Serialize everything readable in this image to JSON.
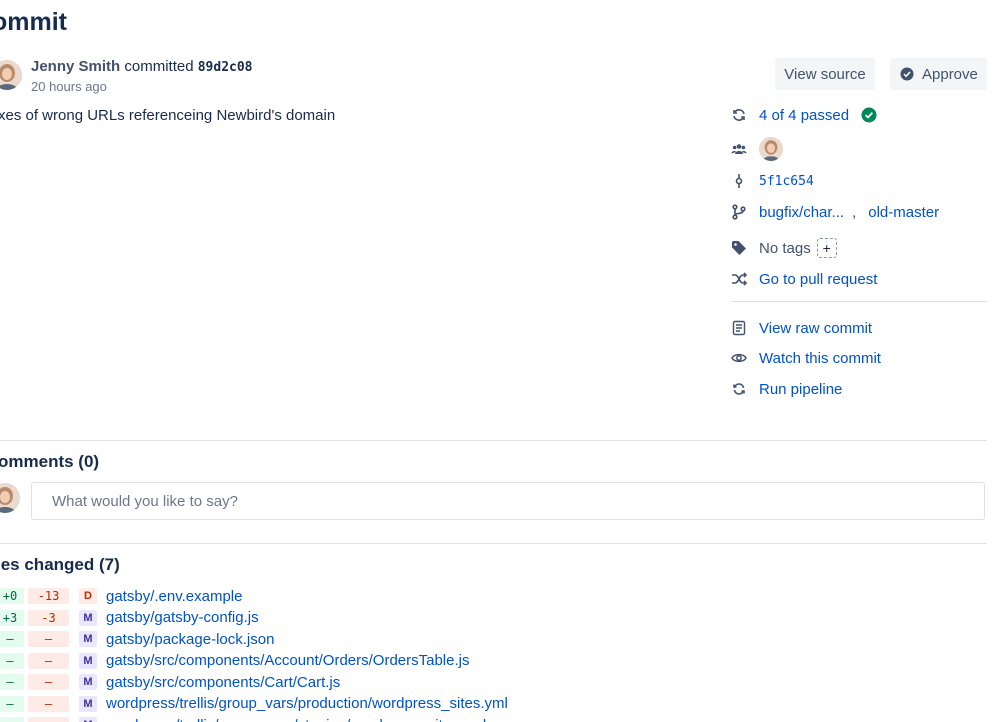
{
  "page": {
    "title": "ommit"
  },
  "commit": {
    "author": "Jenny Smith",
    "verb": "committed",
    "hash": "89d2c08",
    "time_ago": "20 hours ago",
    "message": "xes of wrong URLs referenceing Newbird's domain"
  },
  "actions": {
    "view_source": "View source",
    "approve": "Approve"
  },
  "sidebar": {
    "builds": "4 of 4 passed",
    "parent_hash": "5f1c654",
    "branch_1": "bugfix/char...",
    "branch_sep": ",",
    "branch_2": "old-master",
    "tags": "No tags",
    "tag_add": "+",
    "pull_request": "Go to pull request",
    "view_raw": "View raw commit",
    "watch": "Watch this commit",
    "run_pipeline": "Run pipeline"
  },
  "comments": {
    "title": "omments (0)",
    "placeholder": "What would you like to say?"
  },
  "files": {
    "title": "les changed (7)",
    "rows": [
      {
        "add": "+0",
        "del": "-13",
        "status": "D",
        "path": "gatsby/.env.example"
      },
      {
        "add": "+3",
        "del": "-3",
        "status": "M",
        "path": "gatsby/gatsby-config.js"
      },
      {
        "add": "—",
        "del": "—",
        "status": "M",
        "path": "gatsby/package-lock.json"
      },
      {
        "add": "—",
        "del": "—",
        "status": "M",
        "path": "gatsby/src/components/Account/Orders/OrdersTable.js"
      },
      {
        "add": "—",
        "del": "—",
        "status": "M",
        "path": "gatsby/src/components/Cart/Cart.js"
      },
      {
        "add": "—",
        "del": "—",
        "status": "M",
        "path": "wordpress/trellis/group_vars/production/wordpress_sites.yml"
      },
      {
        "add": "—",
        "del": "—",
        "status": "M",
        "path": "wordpress/trellis/group_vars/staging/wordpress_sites.yml"
      }
    ]
  },
  "colors": {
    "link": "#0052cc",
    "text": "#172b4d",
    "success": "#00875a",
    "added_bg": "#e3fcef",
    "removed_bg": "#ffebe6",
    "modified_bg": "#eae6ff"
  },
  "icons": {
    "builds": "refresh-icon",
    "build_status": "check-circle-icon",
    "reviewers": "people-group-icon",
    "parent": "commit-node-icon",
    "branches": "branch-icon",
    "tags": "tag-icon",
    "pull_request": "shuffle-icon",
    "view_raw": "document-icon",
    "watch": "eye-icon",
    "run_pipeline": "pipeline-refresh-icon"
  }
}
